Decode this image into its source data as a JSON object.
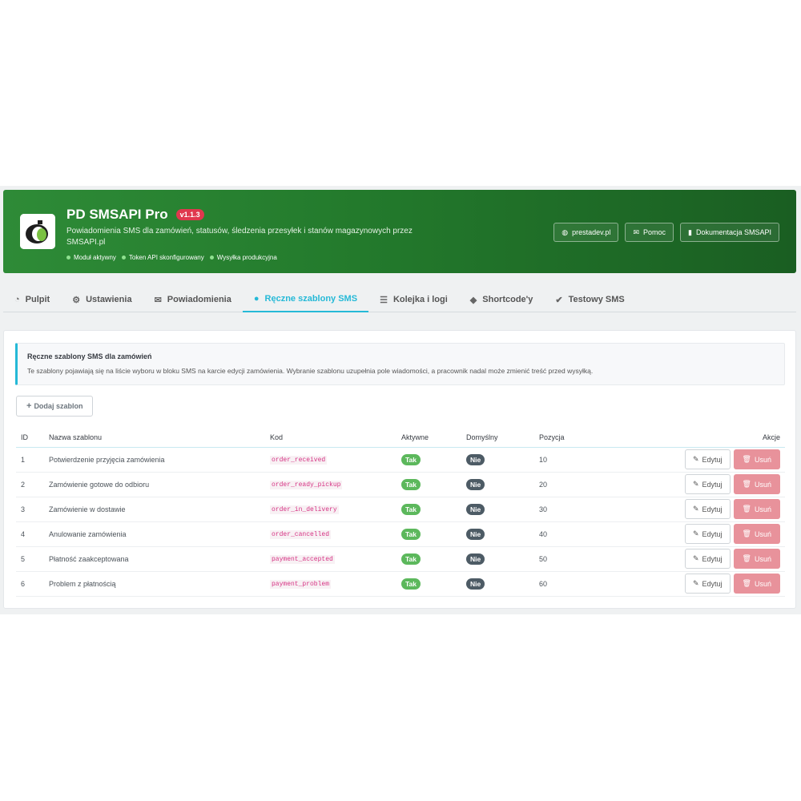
{
  "header": {
    "title": "PD SMSAPI Pro",
    "version": "v1.1.3",
    "description": "Powiadomienia SMS dla zamówień, statusów, śledzenia przesyłek i stanów magazynowych przez SMSAPI.pl",
    "statuses": [
      "Moduł aktywny",
      "Token API skonfigurowany",
      "Wysyłka produkcyjna"
    ],
    "buttons": [
      {
        "label": "prestadev.pl",
        "icon": "globe-icon"
      },
      {
        "label": "Pomoc",
        "icon": "envelope-icon"
      },
      {
        "label": "Dokumentacja SMSAPI",
        "icon": "book-icon"
      }
    ]
  },
  "tabs": [
    {
      "label": "Pulpit",
      "icon": "dashboard-icon",
      "active": false
    },
    {
      "label": "Ustawienia",
      "icon": "cogs-icon",
      "active": false
    },
    {
      "label": "Powiadomienia",
      "icon": "envelope-icon",
      "active": false
    },
    {
      "label": "Ręczne szablony SMS",
      "icon": "comments-icon",
      "active": true
    },
    {
      "label": "Kolejka i logi",
      "icon": "list-icon",
      "active": false
    },
    {
      "label": "Shortcode'y",
      "icon": "tags-icon",
      "active": false
    },
    {
      "label": "Testowy SMS",
      "icon": "check-icon",
      "active": false
    }
  ],
  "info": {
    "title": "Ręczne szablony SMS dla zamówień",
    "text": "Te szablony pojawiają się na liście wyboru w bloku SMS na karcie edycji zamówienia. Wybranie szablonu uzupełnia pole wiadomości, a pracownik nadal może zmienić treść przed wysyłką."
  },
  "add_button": "Dodaj szablon",
  "table": {
    "columns": [
      "ID",
      "Nazwa szablonu",
      "Kod",
      "Aktywne",
      "Domyślny",
      "Pozycja",
      "Akcje"
    ],
    "rows": [
      {
        "id": "1",
        "name": "Potwierdzenie przyjęcia zamówienia",
        "code": "order_received",
        "active": "Tak",
        "default": "Nie",
        "position": "10"
      },
      {
        "id": "2",
        "name": "Zamówienie gotowe do odbioru",
        "code": "order_ready_pickup",
        "active": "Tak",
        "default": "Nie",
        "position": "20"
      },
      {
        "id": "3",
        "name": "Zamówienie w dostawie",
        "code": "order_in_delivery",
        "active": "Tak",
        "default": "Nie",
        "position": "30"
      },
      {
        "id": "4",
        "name": "Anulowanie zamówienia",
        "code": "order_cancelled",
        "active": "Tak",
        "default": "Nie",
        "position": "40"
      },
      {
        "id": "5",
        "name": "Płatność zaakceptowana",
        "code": "payment_accepted",
        "active": "Tak",
        "default": "Nie",
        "position": "50"
      },
      {
        "id": "6",
        "name": "Problem z płatnością",
        "code": "payment_problem",
        "active": "Tak",
        "default": "Nie",
        "position": "60"
      }
    ],
    "edit_label": "Edytuj",
    "delete_label": "Usuń"
  },
  "colors": {
    "header_green": "#2e8b37",
    "accent": "#25b9d7",
    "badge_yes": "#5cb85c",
    "badge_no": "#4d5b65",
    "delete": "#e8929b"
  }
}
